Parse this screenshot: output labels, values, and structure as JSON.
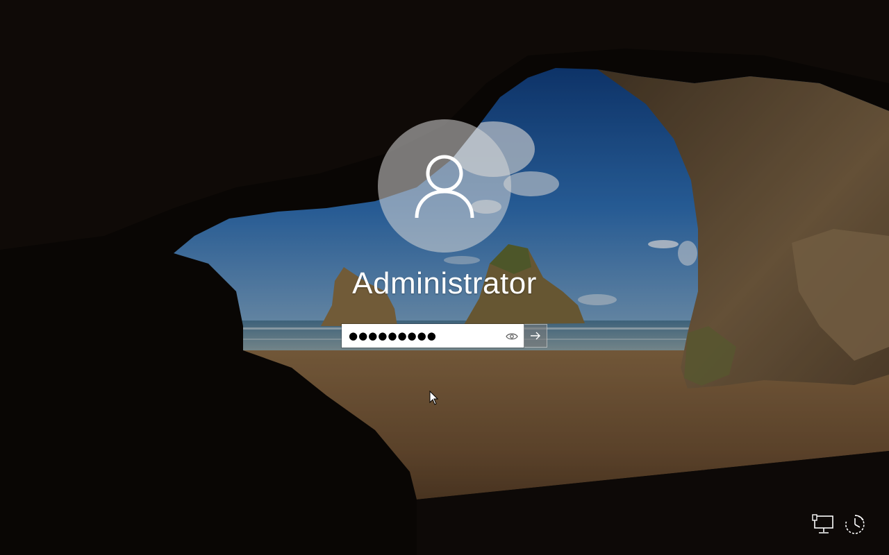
{
  "login": {
    "username": "Administrator",
    "password_masked": "●●●●●●●●●",
    "reveal_icon": "eye-icon",
    "submit_icon": "arrow-right-icon"
  },
  "avatar_icon": "user-silhouette-icon",
  "corner_icons": {
    "network": "network-icon",
    "ease_of_access": "ease-of-access-icon"
  },
  "colors": {
    "text": "#ffffff",
    "avatar_bg": "#d7d7d7",
    "submit_bg": "#787878"
  }
}
